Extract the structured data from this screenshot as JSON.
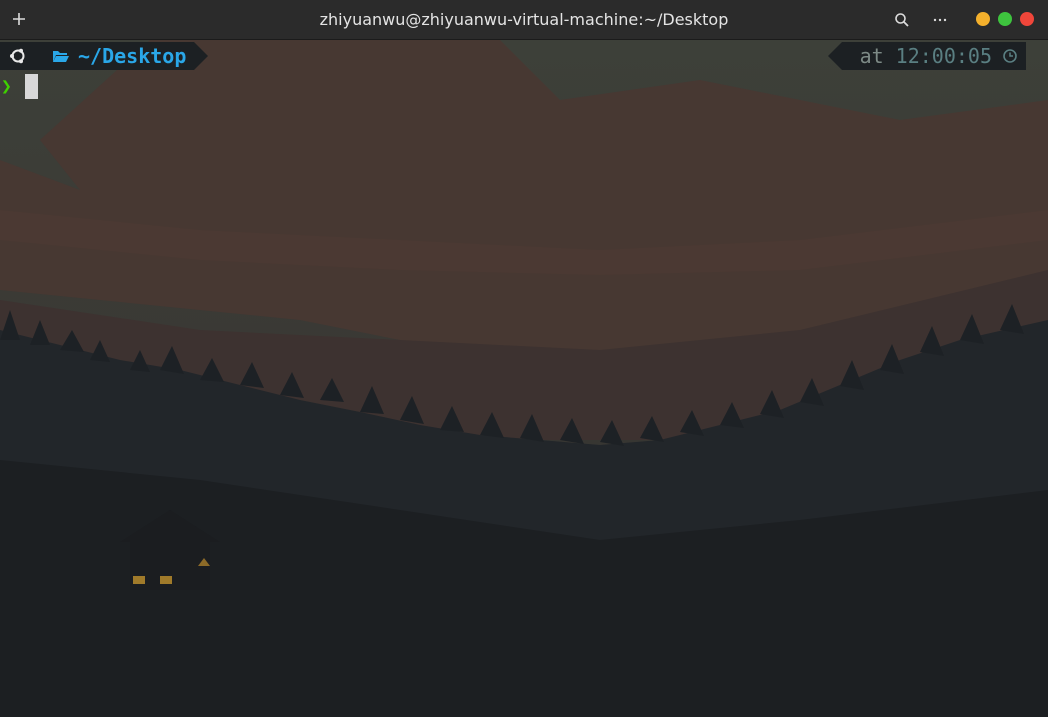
{
  "window": {
    "title": "zhiyuanwu@zhiyuanwu-virtual-machine:~/Desktop",
    "controls": [
      "minimize",
      "maximize",
      "close"
    ],
    "control_colors": {
      "minimize": "#f4b02c",
      "maximize": "#3ec43e",
      "close": "#f0463a"
    }
  },
  "toolbar": {
    "new_tab_icon": "plus-icon",
    "search_icon": "search-icon",
    "menu_icon": "more-horizontal-icon"
  },
  "prompt": {
    "os_icon": "ubuntu-logo-icon",
    "dir_icon": "folder-open-icon",
    "directory": "~/Desktop",
    "directory_color": "#2aa7e8",
    "right_prefix": "at",
    "time": "12:00:05",
    "time_icon": "clock-icon",
    "prompt_symbol": "❯",
    "prompt_color": "#3ed100"
  },
  "terminal": {
    "background": "forest landscape wallpaper"
  }
}
